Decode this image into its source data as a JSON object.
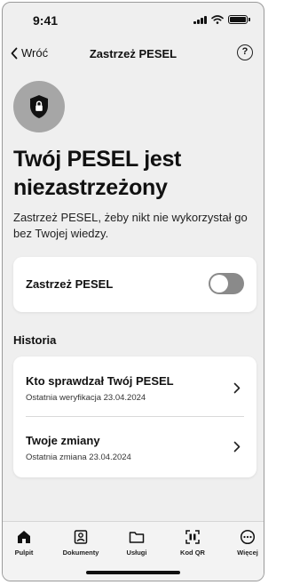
{
  "status": {
    "time": "9:41"
  },
  "nav": {
    "back_label": "Wróć",
    "title": "Zastrzeż PESEL",
    "help_label": "?"
  },
  "hero": {
    "icon": "shield-lock-icon",
    "heading": "Twój PESEL jest niezastrzeżony",
    "description": "Zastrzeż PESEL, żeby nikt nie wykorzystał go bez Twojej wiedzy."
  },
  "toggle_card": {
    "label": "Zastrzeż PESEL",
    "state": "off"
  },
  "history": {
    "title": "Historia",
    "items": [
      {
        "title": "Kto sprawdzał Twój PESEL",
        "subtitle": "Ostatnia weryfikacja 23.04.2024"
      },
      {
        "title": "Twoje zmiany",
        "subtitle": "Ostatnia zmiana 23.04.2024"
      }
    ]
  },
  "tabs": [
    {
      "label": "Pulpit",
      "icon": "home-icon",
      "active": true
    },
    {
      "label": "Dokumenty",
      "icon": "documents-icon",
      "active": false
    },
    {
      "label": "Usługi",
      "icon": "folder-icon",
      "active": false
    },
    {
      "label": "Kod QR",
      "icon": "qr-scan-icon",
      "active": false
    },
    {
      "label": "Więcej",
      "icon": "more-icon",
      "active": false
    }
  ],
  "colors": {
    "background": "#efefef",
    "card": "#ffffff",
    "toggle_off": "#8a8a8a",
    "icon_circle": "#a6a6a6"
  }
}
